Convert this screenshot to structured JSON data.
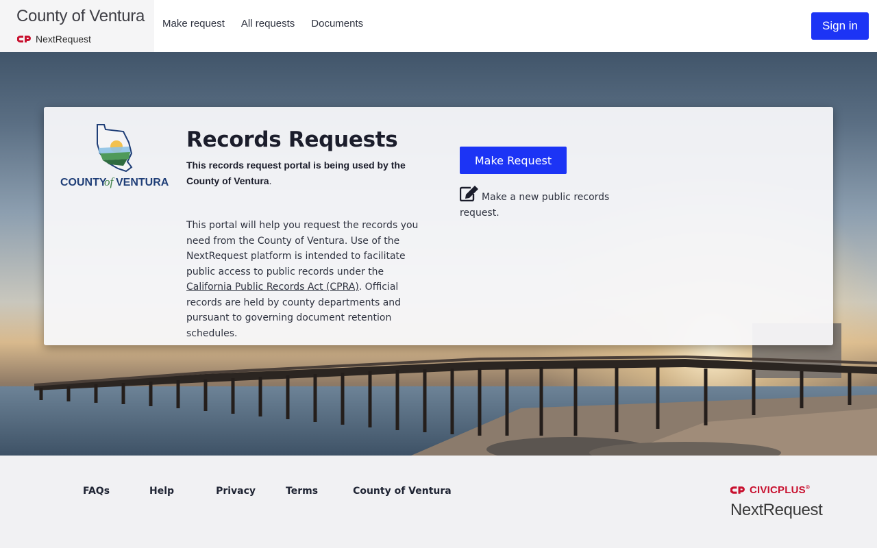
{
  "header": {
    "brand_title": "County of Ventura",
    "brand_sub": "NextRequest",
    "nav": [
      "Make request",
      "All requests",
      "Documents"
    ],
    "sign_in": "Sign in"
  },
  "card": {
    "logo_text_left": "COUNTY",
    "logo_text_of": "of",
    "logo_text_right": "VENTURA",
    "title": "Records Requests",
    "lead_bold": "This records request portal is being used by the County of Ventura",
    "lead_end": ".",
    "body_before": "This portal will help you request the records you need from the County of Ventura. Use of the NextRequest platform is intended to facilitate public access to public records under the ",
    "body_link": "California Public Records Act (CPRA)",
    "body_after": ". Official records are held by county departments and pursuant to governing document retention schedules.",
    "make_request_button": "Make Request",
    "make_request_desc": "Make a new public records request."
  },
  "footer": {
    "links": [
      "FAQs",
      "Help",
      "Privacy",
      "Terms",
      "County of Ventura"
    ],
    "civic_brand": "CIVICPLUS",
    "civic_tm": "®",
    "civic_product": "NextRequest"
  },
  "colors": {
    "primary": "#1c34f5",
    "civic_red": "#c8102e"
  }
}
